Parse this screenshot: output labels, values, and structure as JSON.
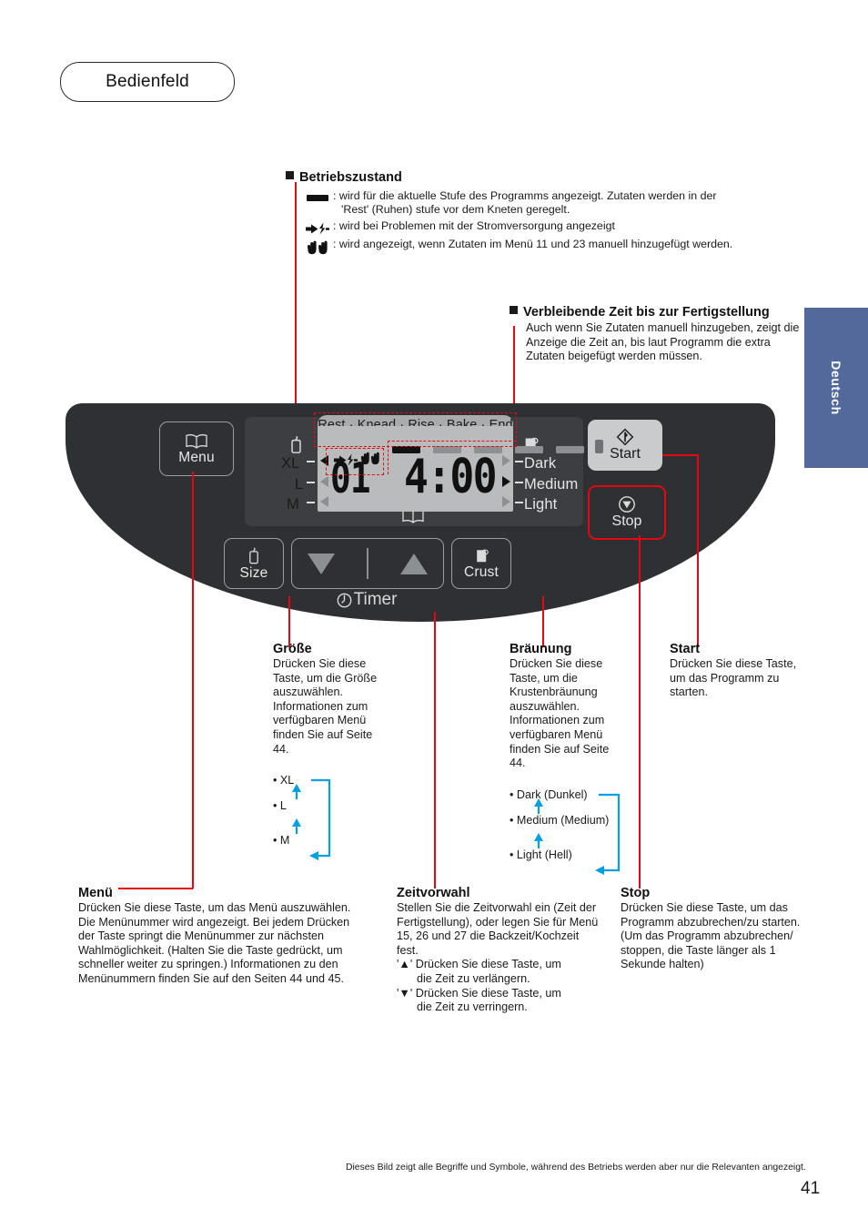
{
  "title": "Bedienfeld",
  "language_tab": "Deutsch",
  "operating_state": {
    "heading": "Betriebszustand",
    "rows": [
      {
        "icon": "bar-icon",
        "text": ": wird für die aktuelle Stufe des Programms angezeigt. Zutaten werden in der",
        "text2": "'Rest' (Ruhen) stufe vor dem Kneten geregelt."
      },
      {
        "icon": "power-plug-icon",
        "text": ": wird bei Problemen mit der Stromversorgung angezeigt",
        "text2": ""
      },
      {
        "icon": "hands-icon",
        "text": ": wird angezeigt, wenn Zutaten im Menü 11 und 23 manuell hinzugefügt werden.",
        "text2": ""
      }
    ]
  },
  "remaining_time": {
    "heading": "Verbleibende Zeit bis zur Fertigstellung",
    "body": "Auch wenn Sie Zutaten manuell hinzugeben, zeigt die Anzeige die Zeit an, bis laut Programm die extra Zutaten beigefügt werden müssen."
  },
  "panel": {
    "buttons": {
      "menu": "Menu",
      "size": "Size",
      "crust": "Crust",
      "start": "Start",
      "stop": "Stop",
      "timer": "Timer"
    },
    "lcd": {
      "stages": "Rest · Knead · Rise · Bake · End",
      "segments": [
        true,
        false,
        false,
        false,
        false
      ],
      "size_labels": [
        "XL",
        "L",
        "M"
      ],
      "crust_labels": [
        "Dark",
        "Medium",
        "Light"
      ],
      "menu_number": "01",
      "time": "4:00"
    }
  },
  "columns": {
    "groesse": {
      "heading": "Größe",
      "body": "Drücken Sie diese Taste, um die Größe auszuwählen. Informationen zum verfügbaren Menü finden Sie auf Seite 44.",
      "cycle": [
        "• XL",
        "• L",
        "• M"
      ]
    },
    "braeunung": {
      "heading": "Bräunung",
      "body": "Drücken Sie diese Taste, um die Krustenbräunung auszuwählen. Informationen zum verfügbaren Menü finden Sie auf Seite 44.",
      "cycle": [
        "• Dark (Dunkel)",
        "• Medium (Medium)",
        "• Light (Hell)"
      ]
    },
    "start": {
      "heading": "Start",
      "body": "Drücken Sie diese Taste, um das Programm zu starten."
    },
    "menue": {
      "heading": "Menü",
      "body": "Drücken Sie diese Taste, um das Menü auszuwählen. Die Menünummer wird angezeigt. Bei jedem Drücken der Taste springt die Menünummer zur nächsten Wahlmöglichkeit. (Halten Sie die Taste gedrückt, um schneller weiter zu springen.) Informationen zu den Menünummern finden Sie auf den Seiten 44 und 45."
    },
    "zeitvorwahl": {
      "heading": "Zeitvorwahl",
      "body": "Stellen Sie die Zeitvorwahl ein (Zeit der Fertigstellung), oder legen Sie für Menü 15, 26 und 27 die Backzeit/Kochzeit fest.",
      "up_line1": "'▲' Drücken Sie diese Taste, um",
      "up_line2": "die Zeit zu verlängern.",
      "down_line1": "'▼' Drücken Sie diese Taste, um",
      "down_line2": "die Zeit zu verringern."
    },
    "stop": {
      "heading": "Stop",
      "body": "Drücken Sie diese Taste, um das Programm abzubrechen/zu starten. (Um das Programm abzubrechen/ stoppen, die Taste länger als 1 Sekunde halten)"
    }
  },
  "footer": {
    "note": "Dieses Bild zeigt alle Begriffe und Symbole, während des Betriebs werden aber nur die Relevanten angezeigt.",
    "page": "41"
  },
  "colors": {
    "accent_red": "#e30613",
    "cyan": "#00a0e0",
    "tab_blue": "#53699b"
  }
}
